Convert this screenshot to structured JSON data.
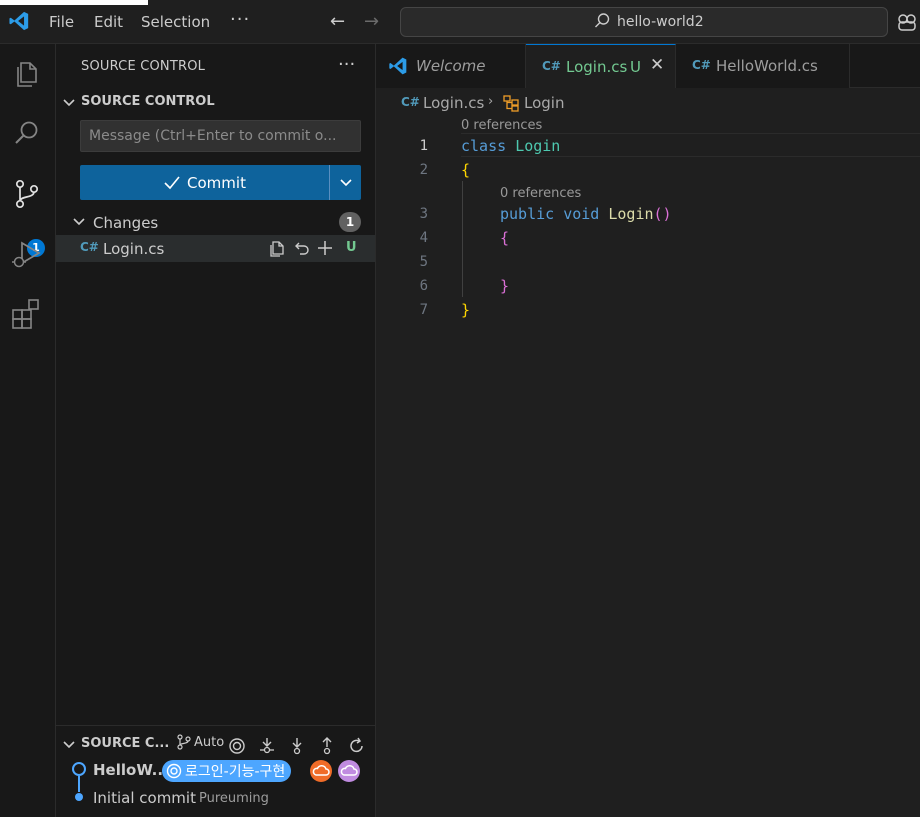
{
  "menu": {
    "file": "File",
    "edit": "Edit",
    "selection": "Selection",
    "more": "···"
  },
  "search": {
    "text": "hello-world2"
  },
  "sidebar": {
    "title": "SOURCE CONTROL",
    "more": "···",
    "section_title": "SOURCE CONTROL",
    "message_placeholder": "Message (Ctrl+Enter to commit o...",
    "commit_label": "Commit",
    "changes_label": "Changes",
    "changes_count": "1",
    "file_name": "Login.cs",
    "file_status": "U",
    "activity_badge": "1"
  },
  "graph": {
    "title": "SOURCE C...",
    "auto_label": "Auto",
    "commits": [
      {
        "label": "HelloW...",
        "branch": "로그인-기능-구현"
      },
      {
        "label": "Initial commit",
        "author": "Pureuming"
      }
    ]
  },
  "tabs": [
    {
      "label": "Welcome"
    },
    {
      "label": "Login.cs",
      "status": "U"
    },
    {
      "label": "HelloWorld.cs"
    }
  ],
  "breadcrumb": {
    "file": "Login.cs",
    "symbol": "Login"
  },
  "editor": {
    "lens1": "0 references",
    "lens2": "0 references",
    "lines": [
      {
        "n": "1",
        "kw": "class",
        "name": "Login"
      },
      {
        "n": "2",
        "text": "{"
      },
      {
        "n": "3",
        "kw1": "public",
        "kw2": "void",
        "fn": "Login",
        "parens": "()"
      },
      {
        "n": "4",
        "text": "{"
      },
      {
        "n": "5",
        "text": ""
      },
      {
        "n": "6",
        "text": "}"
      },
      {
        "n": "7",
        "text": "}"
      }
    ]
  },
  "colors": {
    "accent": "#0078d4",
    "button": "#0e639c",
    "untracked": "#73c991"
  }
}
